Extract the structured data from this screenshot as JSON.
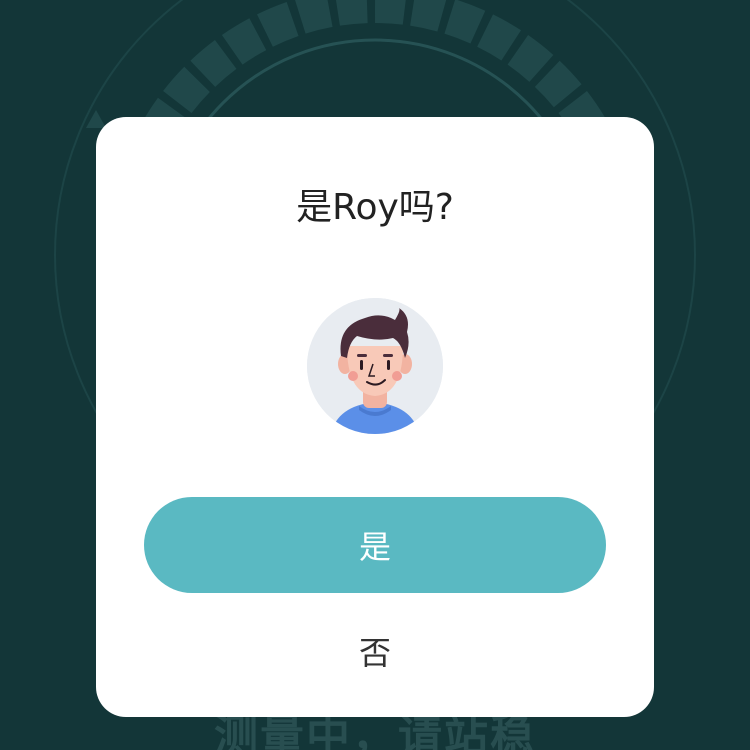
{
  "background": {
    "status_text": "测量中，请站稳",
    "gauge_icon": "scale-gauge-icon",
    "color": "#153b3d"
  },
  "dialog": {
    "title": "是Roy吗?",
    "avatar_icon": "user-avatar-icon",
    "confirm_label": "是",
    "deny_label": "否",
    "accent_color": "#5ab9c2"
  }
}
